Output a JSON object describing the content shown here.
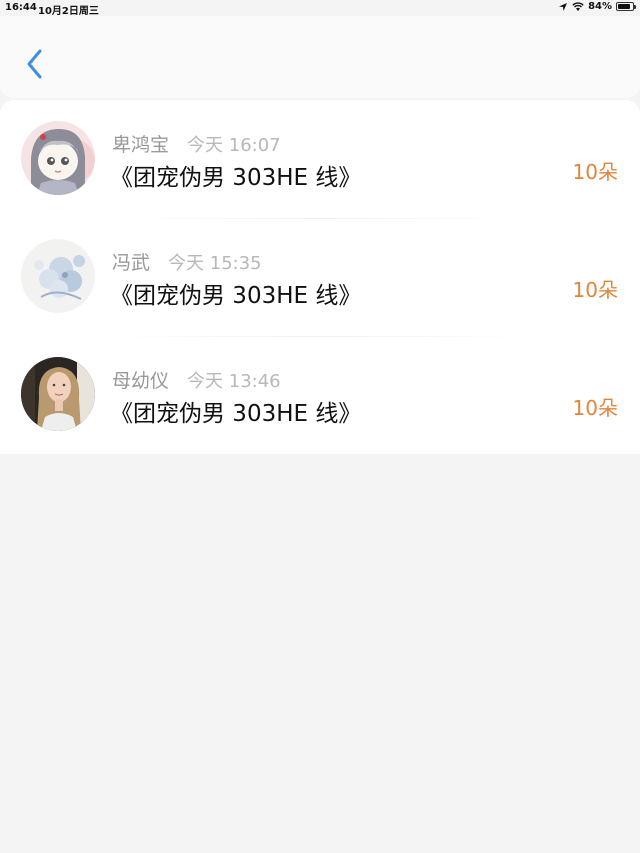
{
  "status_bar": {
    "time": "16:44",
    "date": "10月2日周三",
    "battery": "84%",
    "battery_level": 0.84
  },
  "nav": {
    "back_icon": "chevron-left-icon",
    "accent_color": "#3d8fe0"
  },
  "records": [
    {
      "name": "卑鸿宝",
      "time": "今天 16:07",
      "title": "《团宠伪男 303HE 线》",
      "amount": "10朵"
    },
    {
      "name": "冯武",
      "time": "今天 15:35",
      "title": "《团宠伪男 303HE 线》",
      "amount": "10朵"
    },
    {
      "name": "母幼仪",
      "time": "今天 13:46",
      "title": "《团宠伪男 303HE 线》",
      "amount": "10朵"
    }
  ],
  "colors": {
    "amount": "#e2843a",
    "name": "#999999",
    "time": "#b8b8b8"
  }
}
